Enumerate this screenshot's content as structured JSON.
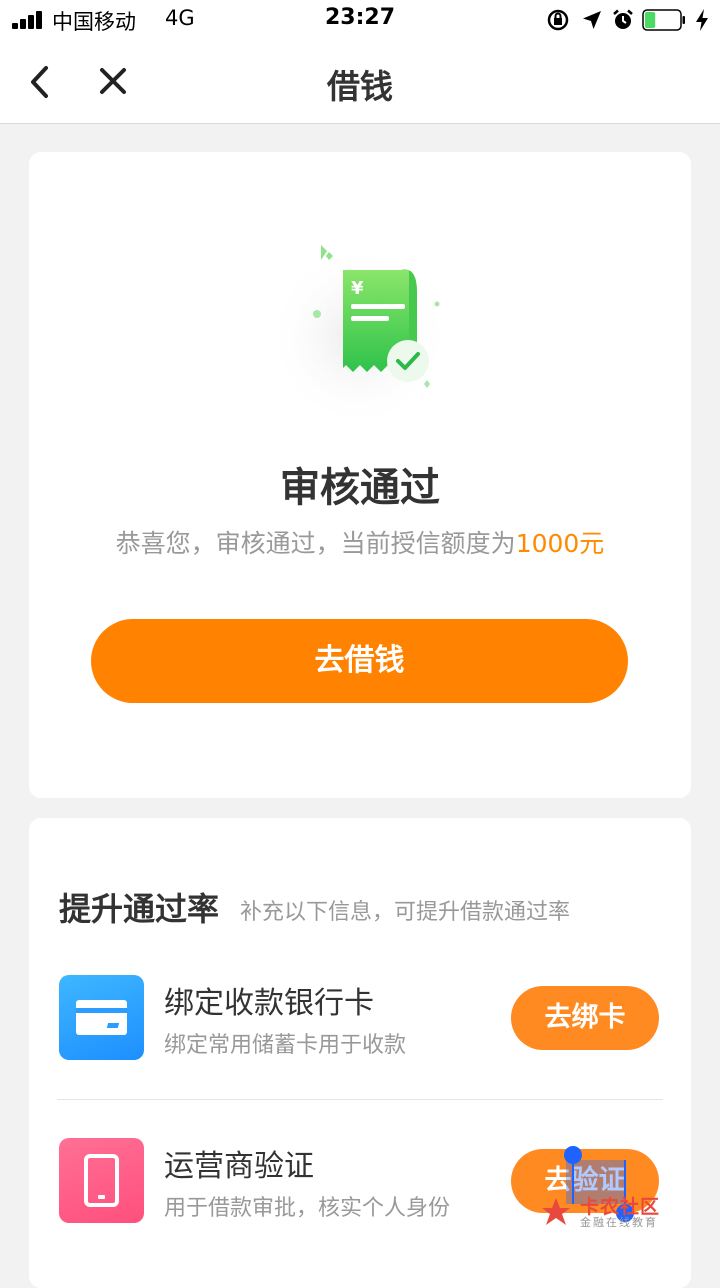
{
  "status_bar": {
    "carrier": "中国移动",
    "network": "4G",
    "time": "23:27",
    "icons": [
      "signal-icon",
      "orientation-lock-icon",
      "location-icon",
      "alarm-icon",
      "battery-icon",
      "charging-icon"
    ],
    "battery_level": 0.3
  },
  "nav": {
    "title": "借钱",
    "back_icon": "chevron-left-icon",
    "close_icon": "close-icon"
  },
  "approval": {
    "illustration": "approved-receipt-icon",
    "title": "审核通过",
    "desc_prefix": "恭喜您，审核通过，当前授信额度为",
    "amount": "1000元",
    "borrow_button": "去借钱"
  },
  "improve": {
    "title": "提升通过率",
    "subtitle": "补充以下信息，可提升借款通过率",
    "items": [
      {
        "icon": "bank-card-icon",
        "title": "绑定收款银行卡",
        "desc": "绑定常用储蓄卡用于收款",
        "button": "去绑卡"
      },
      {
        "icon": "phone-icon",
        "title": "运营商验证",
        "desc": "用于借款审批，核实个人身份",
        "button": "去验证"
      }
    ]
  },
  "watermark": {
    "name": "卡农社区",
    "sub": "金融在线教育"
  },
  "colors": {
    "accent": "#ff8200",
    "amount": "#ff8a00",
    "background": "#f2f2f2",
    "bank_icon": "#2a9dff",
    "phone_icon": "#ff5c85"
  }
}
